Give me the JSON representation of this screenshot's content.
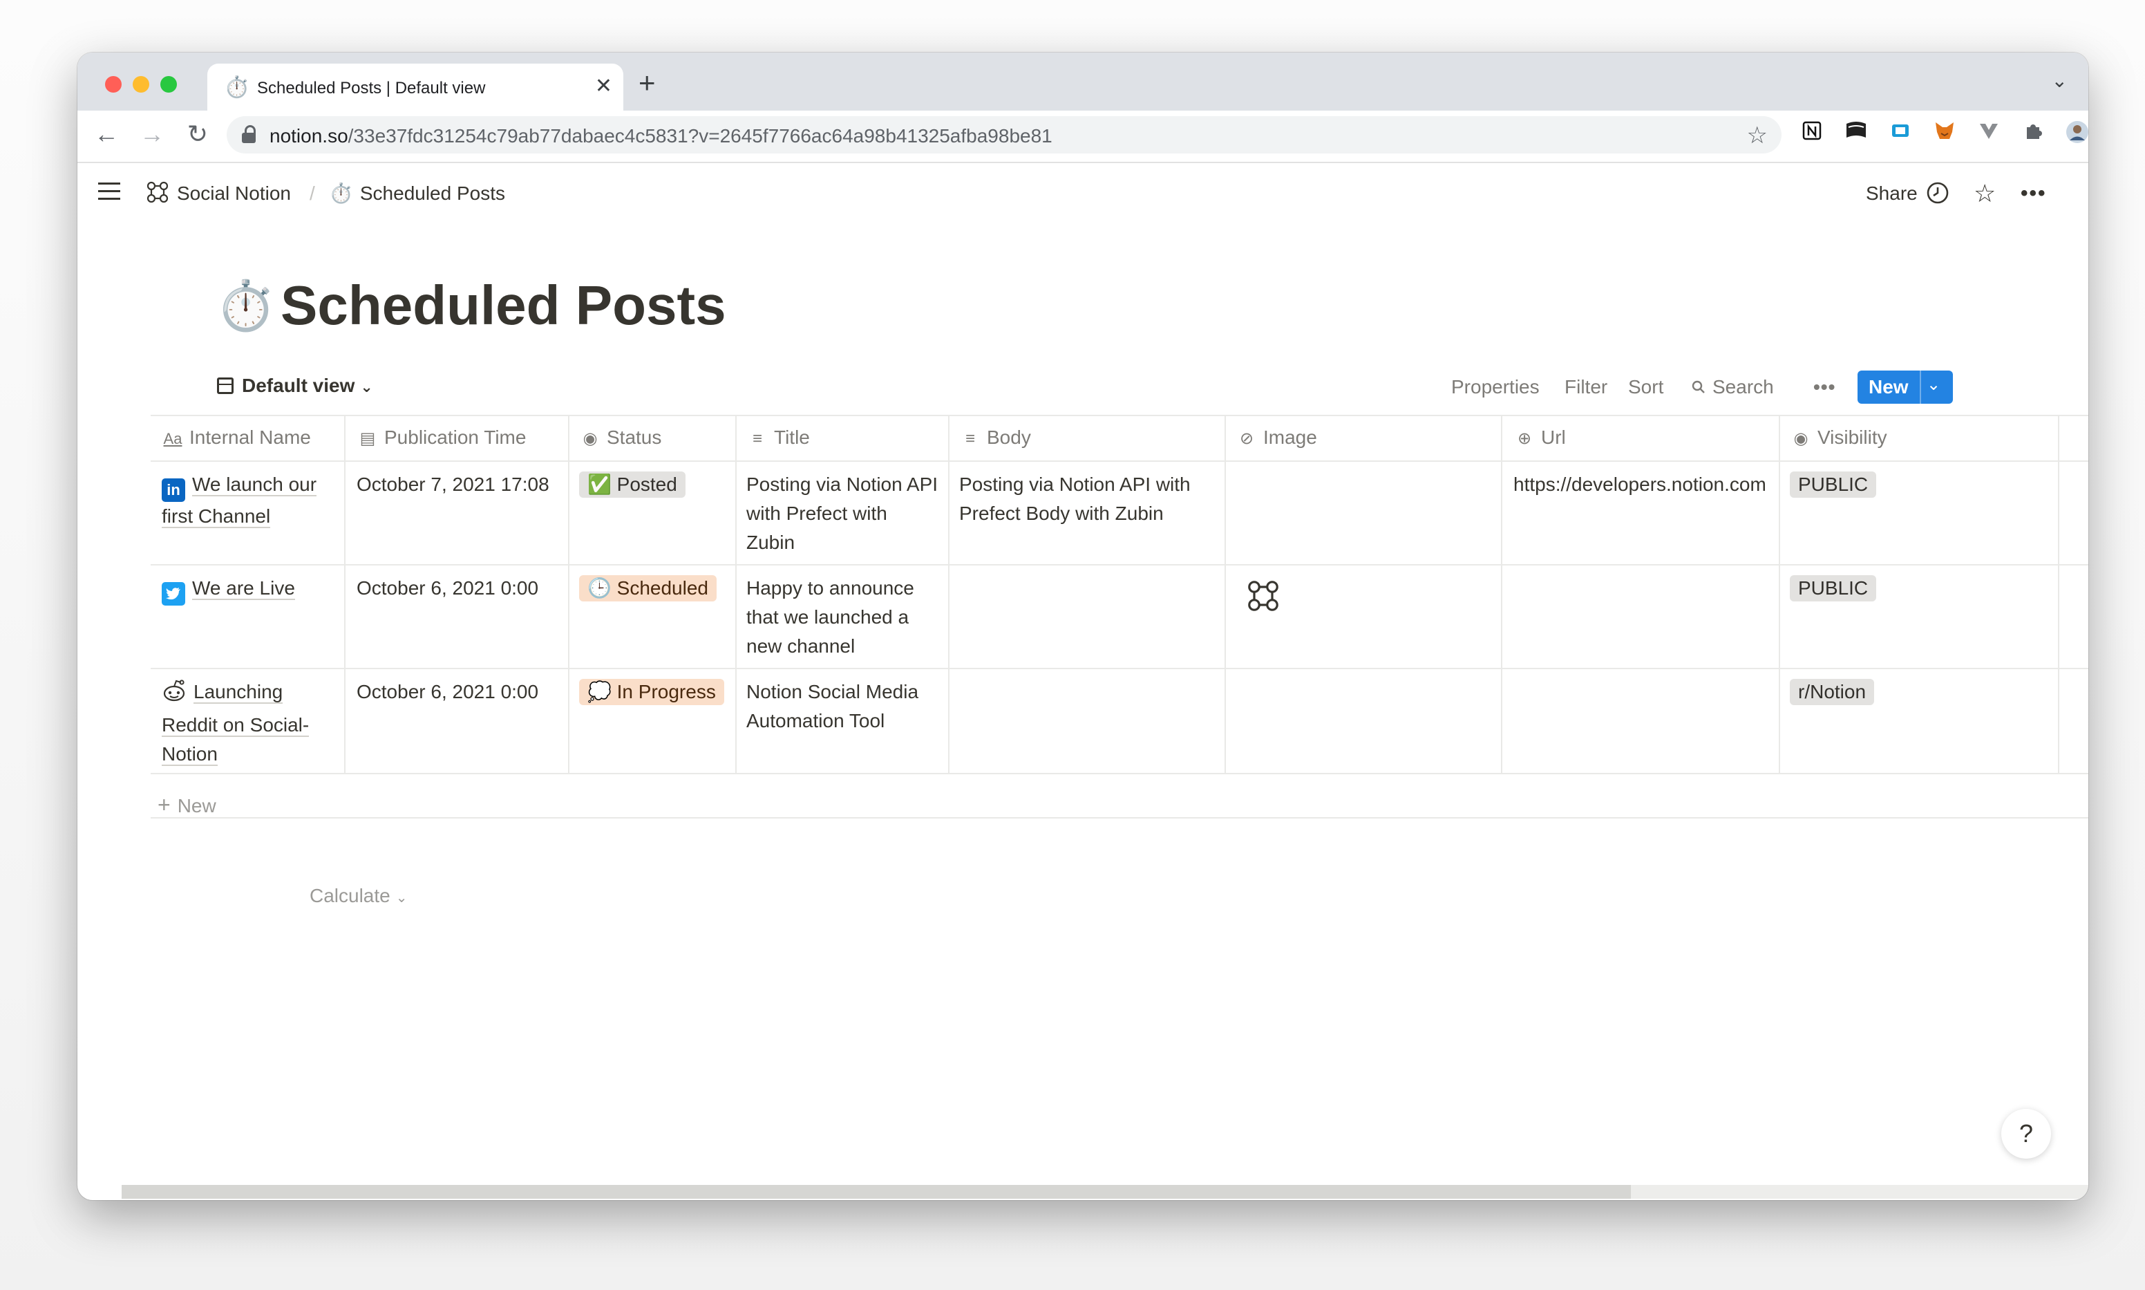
{
  "browser": {
    "tab_icon": "⏱️",
    "tab_title": "Scheduled Posts | Default view",
    "tab_close": "✕",
    "new_tab": "+",
    "url_domain": "notion.so",
    "url_path": "/33e37fdc31254c79ab77dabaec4c5831?v=2645f7766ac64a98b41325afba98be81"
  },
  "topbar": {
    "breadcrumb": [
      "Social Notion",
      "Scheduled Posts"
    ],
    "breadcrumb_separator": "/",
    "share_label": "Share"
  },
  "page": {
    "title": "Scheduled Posts",
    "title_icon": "⏱️"
  },
  "view_bar": {
    "view_name": "Default view",
    "properties": "Properties",
    "filter": "Filter",
    "sort": "Sort",
    "search": "Search",
    "new_label": "New"
  },
  "table": {
    "columns": [
      {
        "label": "Internal Name",
        "icon": "Aa"
      },
      {
        "label": "Publication Time",
        "icon": "calendar-icon"
      },
      {
        "label": "Status",
        "icon": "select-icon"
      },
      {
        "label": "Title",
        "icon": "text-icon"
      },
      {
        "label": "Body",
        "icon": "text-icon"
      },
      {
        "label": "Image",
        "icon": "attachment-icon"
      },
      {
        "label": "Url",
        "icon": "link-icon"
      },
      {
        "label": "Visibility",
        "icon": "select-icon"
      }
    ],
    "rows": [
      {
        "name": "We launch our first Channel",
        "name_icon": "linkedin-icon",
        "time": "October 7, 2021 17:08",
        "status": "Posted",
        "status_icon": "✅",
        "title": "Posting via Notion API with Prefect with Zubin",
        "body": "Posting via Notion API with Prefect Body with Zubin",
        "image": "",
        "url": "https://developers.notion.com",
        "visibility": "PUBLIC"
      },
      {
        "name": "We are Live",
        "name_icon": "twitter-icon",
        "time": "October 6, 2021 0:00",
        "status": "Scheduled",
        "status_icon": "🕒",
        "title": "Happy to announce that we launched a new channel",
        "body": "",
        "image": "logo-thumbnail",
        "url": "",
        "visibility": "PUBLIC"
      },
      {
        "name": "Launching Reddit on Social-Notion",
        "name_icon": "reddit-icon",
        "time": "October 6, 2021 0:00",
        "status": "In Progress",
        "status_icon": "💭",
        "title": "Notion Social Media Automation Tool",
        "body": "",
        "image": "",
        "url": "",
        "visibility": "r/Notion"
      }
    ],
    "new_row_label": "New",
    "calculate_label": "Calculate"
  },
  "help_label": "?",
  "colors": {
    "accent_blue": "#2383e2",
    "text": "#37352f",
    "muted": "#7d7b77"
  }
}
